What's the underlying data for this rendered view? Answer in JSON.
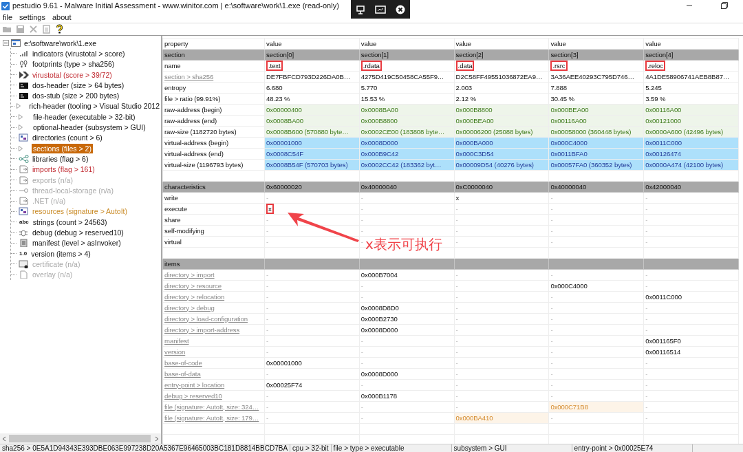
{
  "window": {
    "title": "pestudio 9.61 - Malware Initial Assessment - www.winitor.com | e:\\software\\work\\1.exe (read-only)"
  },
  "menu": [
    "file",
    "settings",
    "about"
  ],
  "toolbar": [
    {
      "disabled": true
    },
    {
      "disabled": true
    },
    {
      "disabled": true
    },
    {
      "disabled": true
    },
    {
      "disabled": false
    }
  ],
  "tree": {
    "label": "e:\\software\\work\\1.exe",
    "expanded": true,
    "children": [
      {
        "label": "indicators (virustotal > score)",
        "kind": "bars",
        "alert": false,
        "unavailable": false,
        "suspicious": false,
        "selected": false
      },
      {
        "label": "footprints (type > sha256)",
        "kind": "footprints",
        "alert": false,
        "unavailable": false,
        "suspicious": false,
        "selected": false
      },
      {
        "label": "virustotal (score > 39/72)",
        "kind": "chevrons",
        "alert": true,
        "unavailable": false,
        "suspicious": false,
        "selected": false
      },
      {
        "label": "dos-header (size > 64 bytes)",
        "kind": "console",
        "alert": false,
        "unavailable": false,
        "suspicious": false,
        "selected": false
      },
      {
        "label": "dos-stub (size > 200 bytes)",
        "kind": "console",
        "alert": false,
        "unavailable": false,
        "suspicious": false,
        "selected": false
      },
      {
        "label": "rich-header (tooling > Visual Studio 2012",
        "kind": "expander",
        "alert": false,
        "unavailable": false,
        "suspicious": false,
        "selected": false
      },
      {
        "label": "file-header (executable > 32-bit)",
        "kind": "expander",
        "alert": false,
        "unavailable": false,
        "suspicious": false,
        "selected": false
      },
      {
        "label": "optional-header (subsystem > GUI)",
        "kind": "expander",
        "alert": false,
        "unavailable": false,
        "suspicious": false,
        "selected": false
      },
      {
        "label": "directories (count > 6)",
        "kind": "grid",
        "alert": false,
        "unavailable": false,
        "suspicious": false,
        "selected": false
      },
      {
        "label": "sections (files > 2)",
        "kind": "expander",
        "alert": false,
        "unavailable": false,
        "suspicious": false,
        "selected": true
      },
      {
        "label": "libraries (flag > 6)",
        "kind": "share",
        "alert": false,
        "unavailable": false,
        "suspicious": false,
        "selected": false
      },
      {
        "label": "imports (flag > 161)",
        "kind": "page",
        "alert": true,
        "unavailable": false,
        "suspicious": false,
        "selected": false
      },
      {
        "label": "exports (n/a)",
        "kind": "page",
        "alert": false,
        "unavailable": true,
        "suspicious": false,
        "selected": false
      },
      {
        "label": "thread-local-storage (n/a)",
        "kind": "key",
        "alert": false,
        "unavailable": true,
        "suspicious": false,
        "selected": false
      },
      {
        "label": ".NET (n/a)",
        "kind": "page",
        "alert": false,
        "unavailable": true,
        "suspicious": false,
        "selected": false
      },
      {
        "label": "resources (signature > AutoIt)",
        "kind": "grid",
        "alert": false,
        "unavailable": false,
        "suspicious": true,
        "selected": false
      },
      {
        "label": "strings (count > 24563)",
        "kind": "text",
        "badge": "abc",
        "alert": false,
        "unavailable": false,
        "suspicious": false,
        "selected": false
      },
      {
        "label": "debug (debug > reserved10)",
        "kind": "bug",
        "alert": false,
        "unavailable": false,
        "suspicious": false,
        "selected": false
      },
      {
        "label": "manifest (level > asInvoker)",
        "kind": "scroll",
        "alert": false,
        "unavailable": false,
        "suspicious": false,
        "selected": false
      },
      {
        "label": "version (items > 4)",
        "kind": "text",
        "badge": "1.0",
        "alert": false,
        "unavailable": false,
        "suspicious": false,
        "selected": false
      },
      {
        "label": "certificate (n/a)",
        "kind": "cert",
        "alert": false,
        "unavailable": true,
        "suspicious": false,
        "selected": false
      },
      {
        "label": "overlay (n/a)",
        "kind": "doc",
        "alert": false,
        "unavailable": true,
        "suspicious": false,
        "selected": false
      }
    ]
  },
  "table": {
    "columns": [
      "property",
      "value",
      "value",
      "value",
      "value",
      "value"
    ],
    "rows": [
      {
        "kind": "group",
        "cells": [
          "section",
          "section[0]",
          "section[1]",
          "section[2]",
          "section[3]",
          "section[4]"
        ]
      },
      {
        "kind": "plain",
        "cells": [
          "name",
          {
            "text": ".text",
            "boxed": true
          },
          {
            "text": ".rdata",
            "boxed": true
          },
          {
            "text": ".data",
            "boxed": true
          },
          {
            "text": ".rsrc",
            "boxed": true
          },
          {
            "text": ".reloc",
            "boxed": true
          }
        ]
      },
      {
        "kind": "link",
        "cells": [
          "section > sha256",
          "DE7FBFCD793D226DA0B…",
          "4275D419C50458CA55F9…",
          "D2C58FF49551036872EA9…",
          "3A36AEE40293C795D746…",
          "4A1DE58906741AEB8B87…"
        ]
      },
      {
        "kind": "plain",
        "cells": [
          "entropy",
          "6.680",
          "5.770",
          "2.003",
          "7.888",
          "5.245"
        ]
      },
      {
        "kind": "plain",
        "cells": [
          "file > ratio (99.91%)",
          "48.23 %",
          "15.53 %",
          "2.12 %",
          "30.45 %",
          "3.59 %"
        ]
      },
      {
        "kind": "raw",
        "cells": [
          "raw-address (begin)",
          "0x00000400",
          "0x0008BA00",
          "0x000B8800",
          "0x000BEA00",
          "0x00116A00"
        ]
      },
      {
        "kind": "raw",
        "cells": [
          "raw-address (end)",
          "0x0008BA00",
          "0x000B8800",
          "0x000BEA00",
          "0x00116A00",
          "0x00121000"
        ]
      },
      {
        "kind": "raw",
        "cells": [
          "raw-size (1182720 bytes)",
          "0x0008B600 (570880 byte…",
          "0x0002CE00 (183808 byte…",
          "0x00006200 (25088 bytes)",
          "0x00058000 (360448 bytes)",
          "0x0000A600 (42496 bytes)"
        ]
      },
      {
        "kind": "virtual",
        "cells": [
          "virtual-address (begin)",
          "0x00001000",
          "0x0008D000",
          "0x000BA000",
          "0x000C4000",
          "0x0011C000"
        ]
      },
      {
        "kind": "virtual",
        "cells": [
          "virtual-address (end)",
          "0x0008C54F",
          "0x000B9C42",
          "0x000C3D54",
          "0x0011BFA0",
          "0x00126474"
        ]
      },
      {
        "kind": "virtual",
        "cells": [
          "virtual-size (1196793 bytes)",
          "0x0008B54F (570703 bytes)",
          "0x0002CC42 (183362 byt…",
          "0x00009D54 (40276 bytes)",
          "0x00057FA0 (360352 bytes)",
          "0x0000A474 (42100 bytes)"
        ]
      },
      {
        "kind": "blank",
        "cells": []
      },
      {
        "kind": "group",
        "cells": [
          "characteristics",
          "0x60000020",
          "0x40000040",
          "0xC0000040",
          "0x40000040",
          "0x42000040"
        ]
      },
      {
        "kind": "plain",
        "cells": [
          "write",
          "-",
          "-",
          "x",
          "-",
          "-"
        ]
      },
      {
        "kind": "plain",
        "cells": [
          "execute",
          {
            "text": "x",
            "boxed": true
          },
          "-",
          "-",
          "-",
          "-"
        ]
      },
      {
        "kind": "plain",
        "cells": [
          "share",
          "-",
          "-",
          "-",
          "-",
          "-"
        ]
      },
      {
        "kind": "plain",
        "cells": [
          "self-modifying",
          "-",
          "-",
          "-",
          "-",
          "-"
        ]
      },
      {
        "kind": "plain",
        "cells": [
          "virtual",
          "-",
          "-",
          "-",
          "-",
          "-"
        ]
      },
      {
        "kind": "blank",
        "cells": []
      },
      {
        "kind": "group",
        "cells": [
          "items"
        ]
      },
      {
        "kind": "link",
        "cells": [
          "directory > import",
          "-",
          "0x000B7004",
          "-",
          "-",
          "-"
        ]
      },
      {
        "kind": "link",
        "cells": [
          "directory > resource",
          "-",
          "-",
          "-",
          "0x000C4000",
          "-"
        ]
      },
      {
        "kind": "link",
        "cells": [
          "directory > relocation",
          "-",
          "-",
          "-",
          "-",
          "0x0011C000"
        ]
      },
      {
        "kind": "link",
        "cells": [
          "directory > debug",
          "-",
          "0x0008D8D0",
          "-",
          "-",
          "-"
        ]
      },
      {
        "kind": "link",
        "cells": [
          "directory > load-configuration",
          "-",
          "0x000B2730",
          "-",
          "-",
          "-"
        ]
      },
      {
        "kind": "link",
        "cells": [
          "directory > import-address",
          "-",
          "0x0008D000",
          "-",
          "-",
          "-"
        ]
      },
      {
        "kind": "link",
        "cells": [
          "manifest",
          "-",
          "-",
          "-",
          "-",
          "0x001165F0"
        ]
      },
      {
        "kind": "link",
        "cells": [
          "version",
          "-",
          "-",
          "-",
          "-",
          "0x00116514"
        ]
      },
      {
        "kind": "link",
        "cells": [
          "base-of-code",
          "0x00001000",
          "-",
          "-",
          "-",
          "-"
        ]
      },
      {
        "kind": "link",
        "cells": [
          "base-of-data",
          "-",
          "0x0008D000",
          "-",
          "-",
          "-"
        ]
      },
      {
        "kind": "link",
        "cells": [
          "entry-point > location",
          "0x00025F74",
          "-",
          "-",
          "-",
          "-"
        ]
      },
      {
        "kind": "link",
        "cells": [
          "debug > reserved10",
          "-",
          "0x000B1178",
          "-",
          "-",
          "-"
        ]
      },
      {
        "kind": "link",
        "cells": [
          "file (signature: AutoIt, size: 324…",
          "-",
          "-",
          "-",
          {
            "text": "0x000C71B8",
            "flagged": true
          },
          "-"
        ]
      },
      {
        "kind": "link",
        "cells": [
          "file (signature: AutoIt, size: 179…",
          "-",
          "-",
          {
            "text": "0x000BA410",
            "flagged": true
          },
          "-",
          "-"
        ]
      },
      {
        "kind": "blank",
        "cells": []
      },
      {
        "kind": "blank",
        "cells": []
      }
    ]
  },
  "annotation": {
    "text": "x表示可执行"
  },
  "status_bar": [
    "sha256 > 0E5A1D94343E393DBE063E997238D20A5367E96465003BC181D8814BBCD7BA",
    "cpu > 32-bit",
    "file > type > executable",
    "subsystem > GUI",
    "entry-point > 0x00025E74"
  ]
}
